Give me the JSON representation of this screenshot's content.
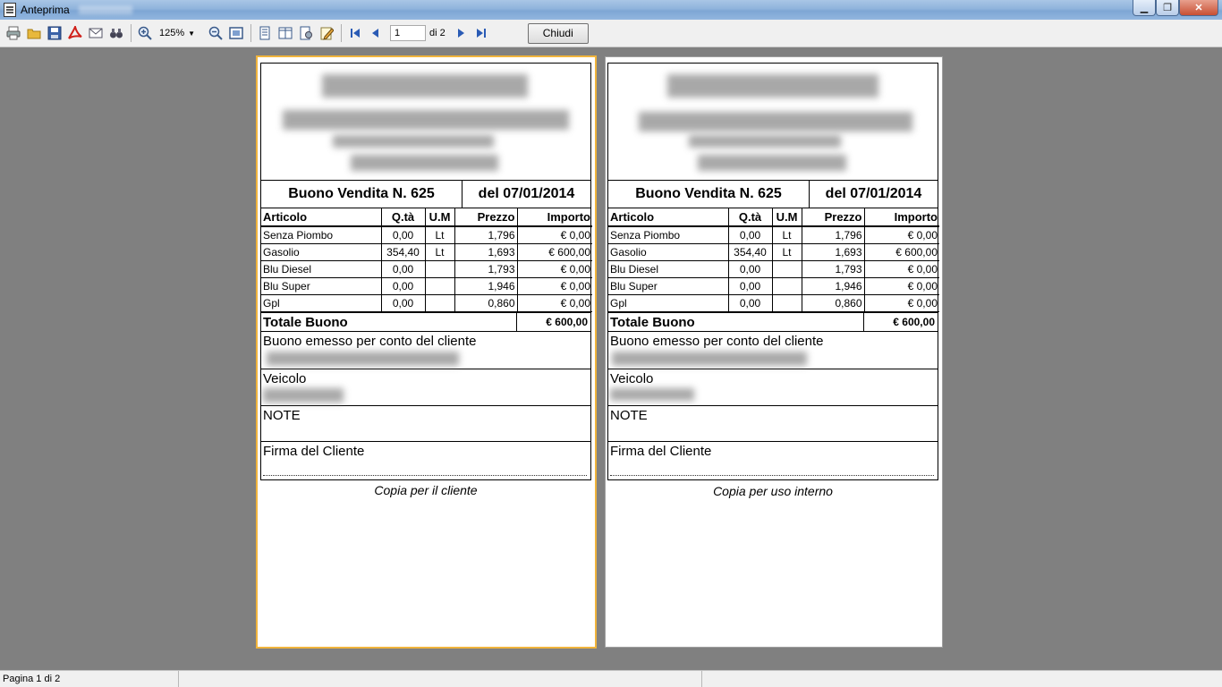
{
  "window": {
    "title": "Anteprima",
    "buttons": {
      "minimize": "▁",
      "restore": "❐",
      "close": "✕"
    }
  },
  "toolbar": {
    "zoom_value": "125%",
    "page_current": "1",
    "page_of": "di 2",
    "close_label": "Chiudi"
  },
  "receipt": {
    "number_label": "Buono Vendita N. 625",
    "date_label": "del 07/01/2014",
    "columns": [
      "Articolo",
      "Q.tà",
      "U.M",
      "Prezzo",
      "Importo"
    ],
    "rows": [
      {
        "articolo": "Senza Piombo",
        "qta": "0,00",
        "um": "Lt",
        "prezzo": "1,796",
        "importo": "€ 0,00"
      },
      {
        "articolo": "Gasolio",
        "qta": "354,40",
        "um": "Lt",
        "prezzo": "1,693",
        "importo": "€ 600,00"
      },
      {
        "articolo": "Blu Diesel",
        "qta": "0,00",
        "um": "",
        "prezzo": "1,793",
        "importo": "€ 0,00"
      },
      {
        "articolo": "Blu Super",
        "qta": "0,00",
        "um": "",
        "prezzo": "1,946",
        "importo": "€ 0,00"
      },
      {
        "articolo": "Gpl",
        "qta": "0,00",
        "um": "",
        "prezzo": "0,860",
        "importo": "€ 0,00"
      }
    ],
    "total_label": "Totale Buono",
    "total_value": "€ 600,00",
    "customer_label": "Buono emesso per conto del cliente",
    "vehicle_label": "Veicolo",
    "note_label": "NOTE",
    "signature_label": "Firma del Cliente"
  },
  "pages": [
    {
      "caption": "Copia per il cliente"
    },
    {
      "caption": "Copia  per uso interno"
    }
  ],
  "status": {
    "page_info": "Pagina 1 di 2"
  },
  "colors": {
    "selected_page_border": "#f0b43c",
    "preview_background": "#808080"
  }
}
